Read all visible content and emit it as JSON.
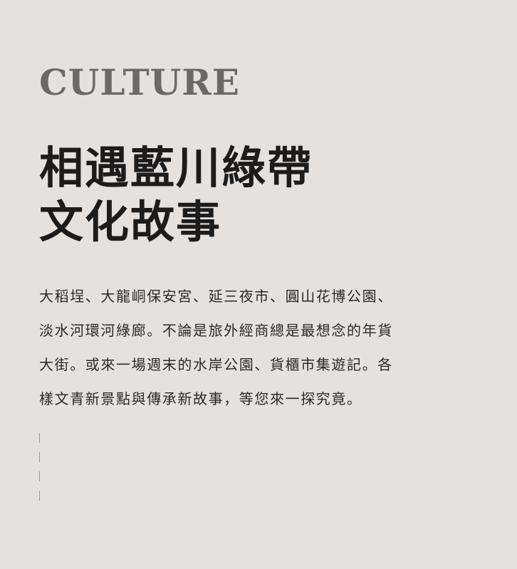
{
  "section": {
    "eyebrow": "CULTURE",
    "headline_lines": [
      "相遇藍川綠帶",
      "文化故事"
    ],
    "body_lines": [
      "大稻埕、大龍峒保安宮、延三夜市、圓山花博公園、",
      "淡水河環河綠廊。不論是旅外經商總是最想念的年貨",
      "大街。或來一場週末的水岸公園、貨櫃市集遊記。各",
      "樣文青新景點與傳承新故事，等您來一探究竟。"
    ]
  },
  "colors": {
    "background": "#e5e1df",
    "eyebrow": "#6b6867",
    "headline": "#1c1c1c",
    "body": "#2a2a2a",
    "divider": "#9a9795"
  }
}
